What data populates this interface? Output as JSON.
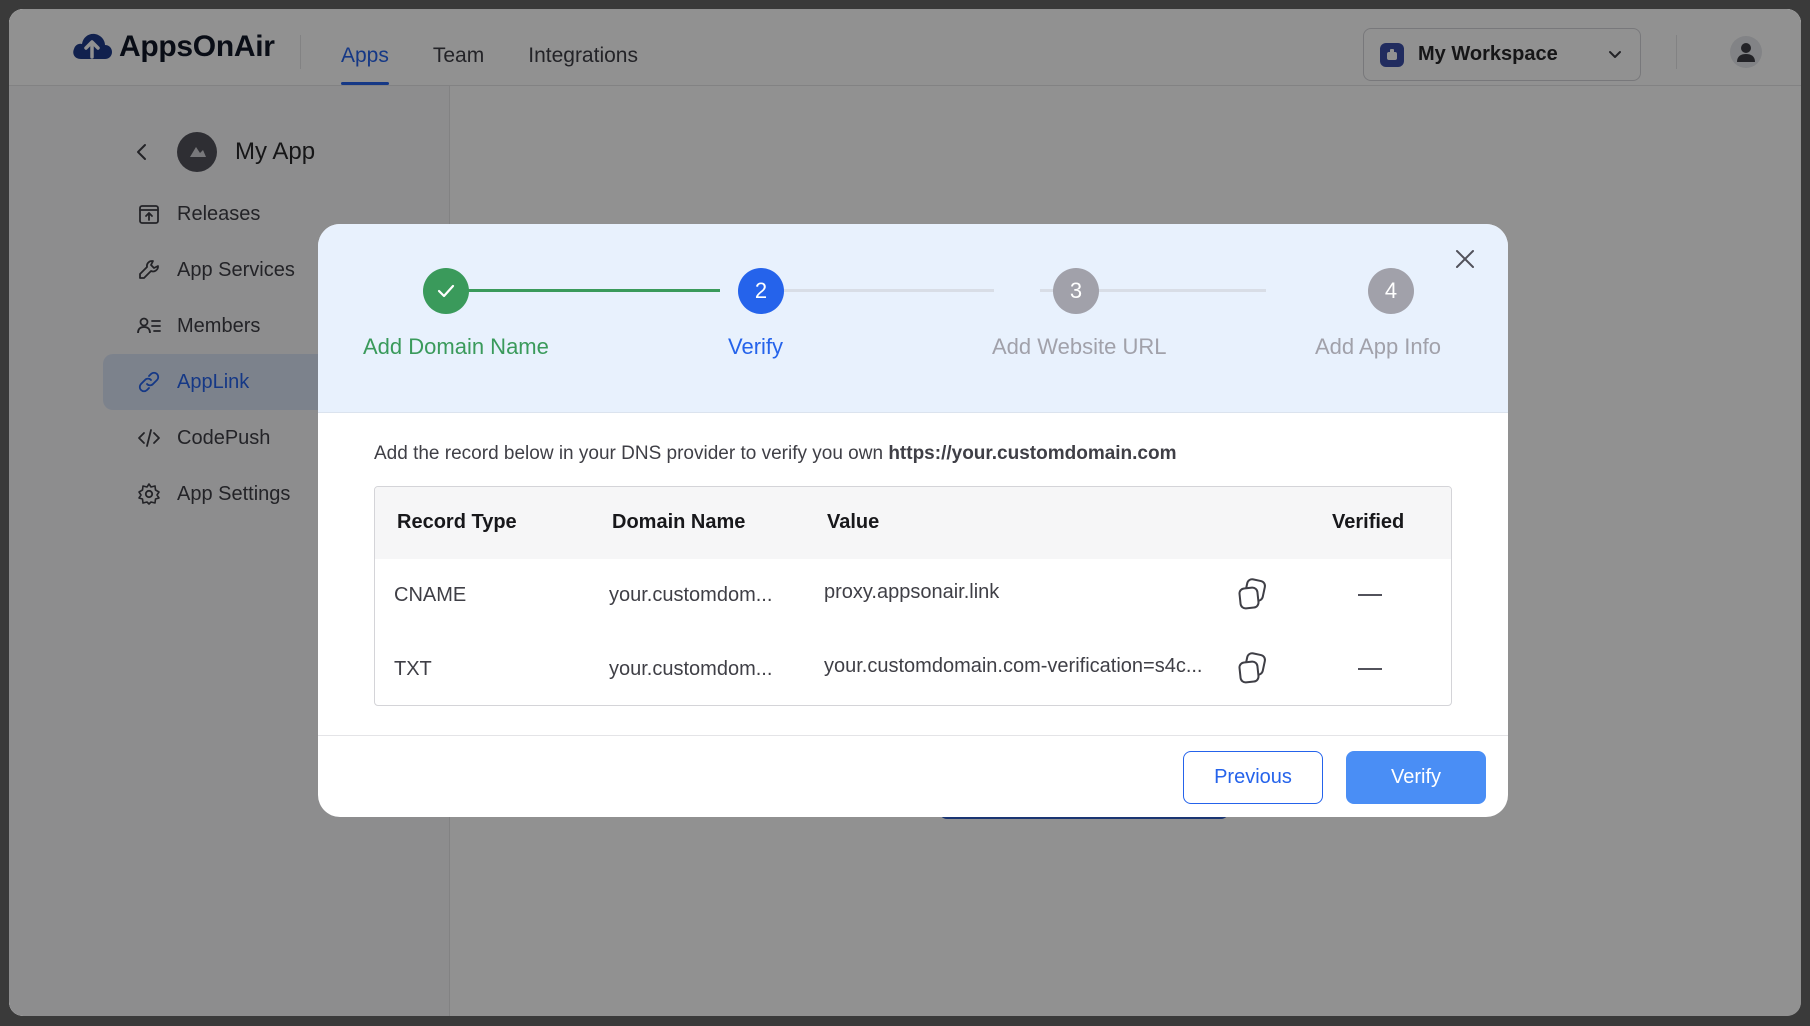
{
  "header": {
    "brand": "AppsOnAir",
    "nav": [
      {
        "label": "Apps",
        "active": true
      },
      {
        "label": "Team",
        "active": false
      },
      {
        "label": "Integrations",
        "active": false
      }
    ],
    "workspace": "My Workspace"
  },
  "sidebar": {
    "app_name": "My App",
    "items": [
      {
        "label": "Releases",
        "icon": "releases-icon"
      },
      {
        "label": "App Services",
        "icon": "wrench-icon"
      },
      {
        "label": "Members",
        "icon": "members-icon"
      },
      {
        "label": "AppLink",
        "icon": "link-icon",
        "active": true
      },
      {
        "label": "CodePush",
        "icon": "code-icon"
      },
      {
        "label": "App Settings",
        "icon": "gear-icon"
      }
    ]
  },
  "modal": {
    "steps": [
      {
        "number": "1",
        "label": "Add Domain Name",
        "state": "completed"
      },
      {
        "number": "2",
        "label": "Verify",
        "state": "active"
      },
      {
        "number": "3",
        "label": "Add Website URL",
        "state": "pending"
      },
      {
        "number": "4",
        "label": "Add App Info",
        "state": "pending"
      }
    ],
    "description_prefix": "Add the record below in your DNS provider to verify you own ",
    "description_domain": "https://your.customdomain.com",
    "table": {
      "headers": [
        "Record Type",
        "Domain Name",
        "Value",
        "Verified"
      ],
      "rows": [
        {
          "type": "CNAME",
          "domain": "your.customdom...",
          "value": "proxy.appsonair.link",
          "verified": "—"
        },
        {
          "type": "TXT",
          "domain": "your.customdom...",
          "value": "your.customdomain.com-verification=s4c...",
          "verified": "—"
        }
      ]
    },
    "buttons": {
      "previous": "Previous",
      "verify": "Verify"
    }
  },
  "colors": {
    "accent": "#2563eb",
    "success": "#3a9a5b",
    "pending": "#a1a1aa",
    "stepper_bg": "#e8f1fd"
  }
}
